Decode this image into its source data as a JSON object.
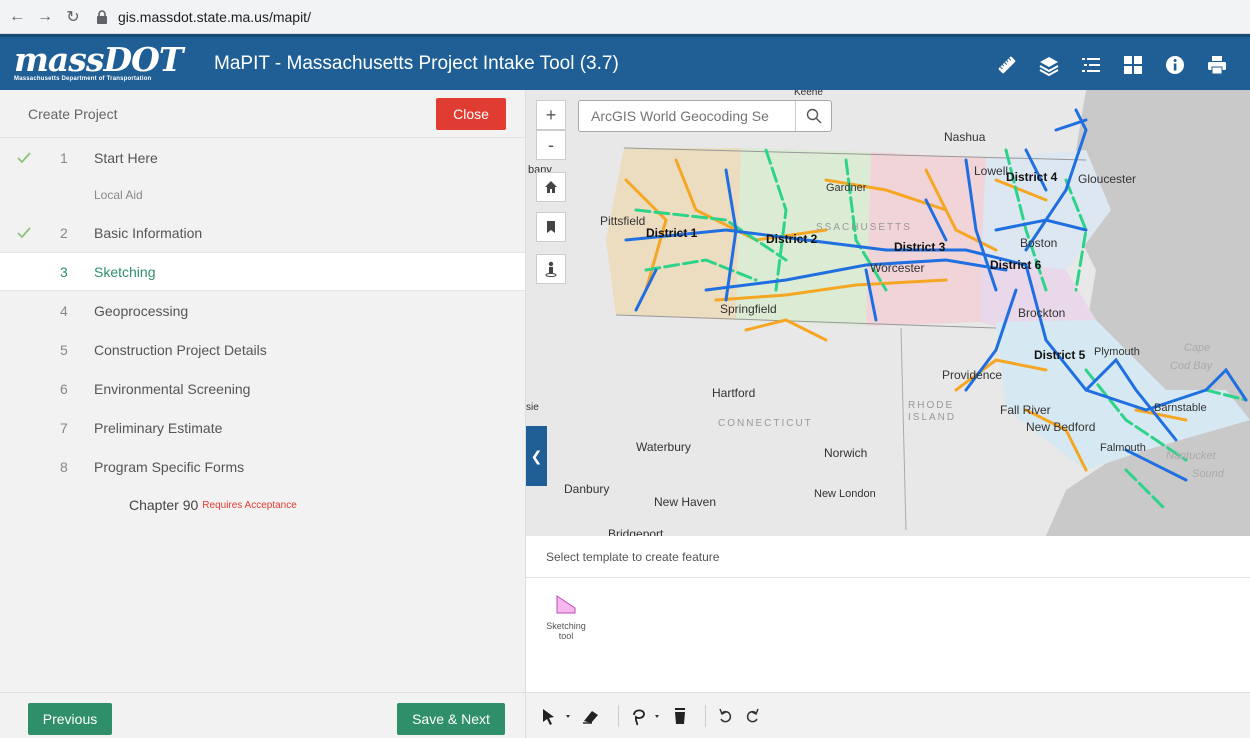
{
  "browser": {
    "url": "gis.massdot.state.ma.us/mapit/"
  },
  "header": {
    "logo_main": "massDOT",
    "logo_sub": "Massachusetts Department of Transportation",
    "title": "MaPIT - Massachusetts Project Intake Tool (3.7)"
  },
  "panel": {
    "title": "Create Project",
    "close_label": "Close",
    "steps": [
      {
        "num": "1",
        "label": "Start Here"
      },
      {
        "num": "2",
        "label": "Basic Information"
      },
      {
        "num": "3",
        "label": "Sketching"
      },
      {
        "num": "4",
        "label": "Geoprocessing"
      },
      {
        "num": "5",
        "label": "Construction Project Details"
      },
      {
        "num": "6",
        "label": "Environmental Screening"
      },
      {
        "num": "7",
        "label": "Preliminary Estimate"
      },
      {
        "num": "8",
        "label": "Program Specific Forms"
      }
    ],
    "substep_local_aid": "Local Aid",
    "chapter": {
      "label": "Chapter 90",
      "note": "Requires Acceptance"
    },
    "previous_label": "Previous",
    "next_label": "Save & Next"
  },
  "map": {
    "search_placeholder": "ArcGIS World Geocoding Se",
    "zoom_in": "+",
    "zoom_out": "-",
    "cities": {
      "keene": "Keene",
      "nashua": "Nashua",
      "albany": "bany",
      "lowell": "Lowell",
      "gloucester": "Gloucester",
      "gardner": "Gardner",
      "pittsfield": "Pittsfield",
      "boston": "Boston",
      "worcester": "Worcester",
      "springfield": "Springfield",
      "brockton": "Brockton",
      "plymouth": "Plymouth",
      "providence": "Providence",
      "hartford": "Hartford",
      "fallriver": "Fall River",
      "newbedford": "New Bedford",
      "barnstable": "Barnstable",
      "falmouth": "Falmouth",
      "waterbury": "Waterbury",
      "norwich": "Norwich",
      "danbury": "Danbury",
      "newhaven": "New Haven",
      "newlondon": "New London",
      "bridgeport": "Bridgeport",
      "sie": "sie"
    },
    "districts": {
      "d1": "District 1",
      "d2": "District 2",
      "d3": "District 3",
      "d4": "District 4",
      "d5": "District 5",
      "d6": "District 6"
    },
    "states": {
      "mass": "SSACHUSETTS",
      "conn": "CONNECTICUT",
      "rhode": "RHODE",
      "island": "ISLAND"
    },
    "waters": {
      "cape": "Cape",
      "codbay": "Cod Bay",
      "nantucket": "Nantucket",
      "sound": "Sound"
    }
  },
  "template": {
    "header": "Select template to create feature",
    "item_label_1": "Sketching",
    "item_label_2": "tool"
  },
  "colors": {
    "header": "#1f5f95",
    "green": "#2e8f69",
    "red": "#e03c31"
  }
}
